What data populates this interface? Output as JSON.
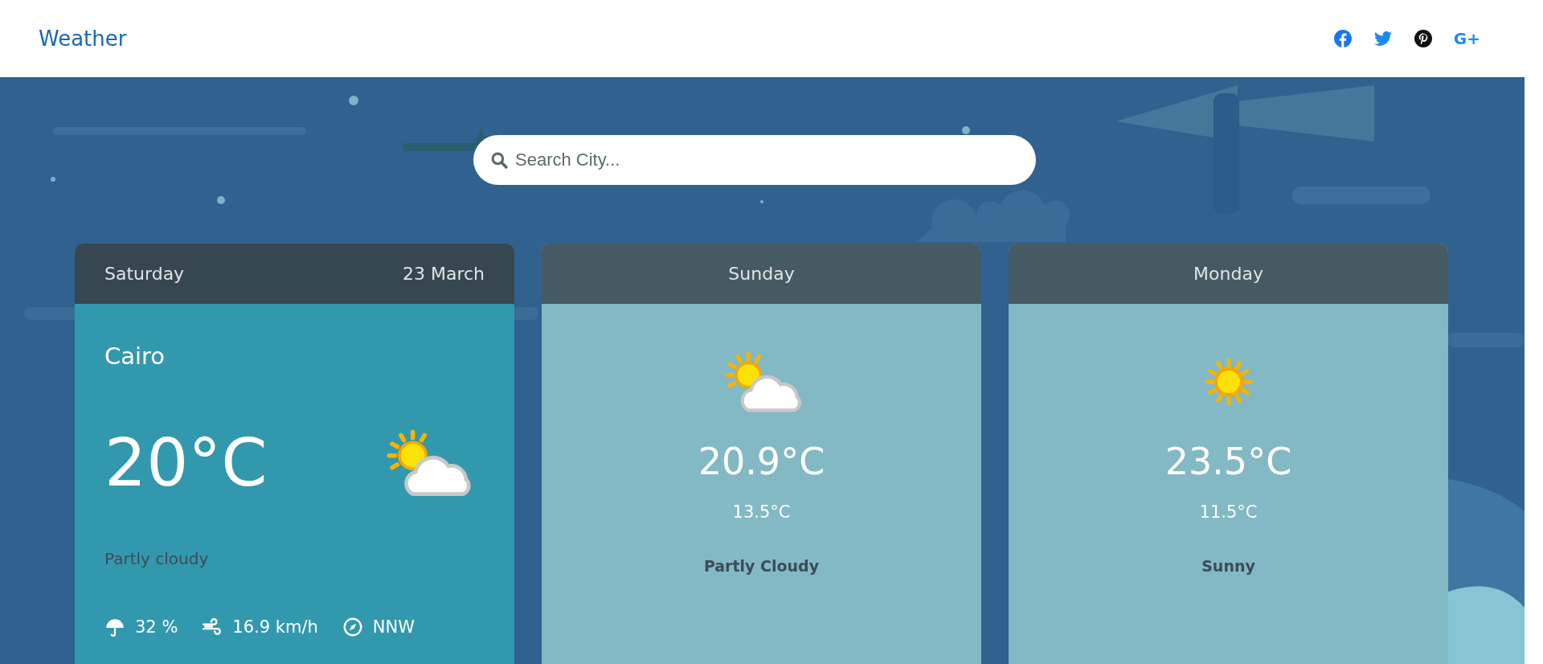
{
  "header": {
    "title": "Weather",
    "social": [
      {
        "kind": "facebook"
      },
      {
        "kind": "twitter"
      },
      {
        "kind": "pinterest"
      },
      {
        "kind": "googleplus",
        "label": "G+"
      }
    ]
  },
  "search": {
    "placeholder": "Search City..."
  },
  "today": {
    "day": "Saturday",
    "date": "23 March",
    "city": "Cairo",
    "temp": "20°C",
    "icon": {
      "kind": "sun-cloud"
    },
    "condition": "Partly cloudy",
    "stats": [
      {
        "kind": "umbrella",
        "text": "32 %"
      },
      {
        "kind": "wind",
        "text": "16.9 km/h"
      },
      {
        "kind": "compass",
        "text": "NNW"
      }
    ]
  },
  "forecast": [
    {
      "day": "Sunday",
      "icon": {
        "kind": "sun-cloud"
      },
      "high": "20.9°C",
      "low": "13.5°C",
      "condition": "Partly Cloudy"
    },
    {
      "day": "Monday",
      "icon": {
        "kind": "sun"
      },
      "high": "23.5°C",
      "low": "11.5°C",
      "condition": "Sunny"
    }
  ]
}
